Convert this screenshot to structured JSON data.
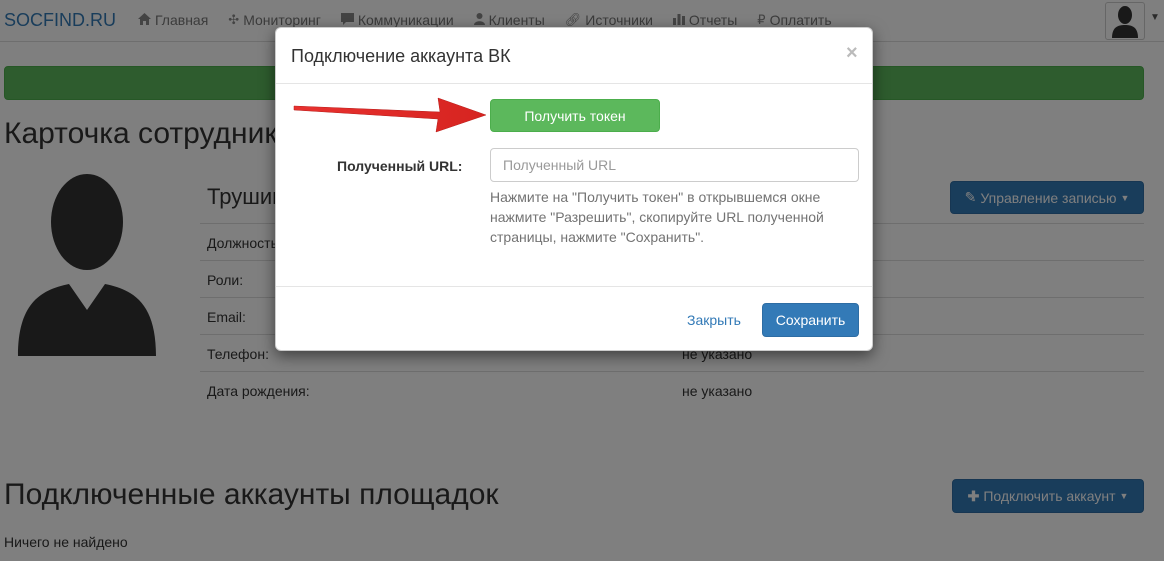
{
  "navbar": {
    "brand": "SOCFIND.RU",
    "items": [
      {
        "label": "Главная",
        "icon": "home-icon"
      },
      {
        "label": "Мониторинг",
        "icon": "crosshair-icon"
      },
      {
        "label": "Коммуникации",
        "icon": "comment-icon"
      },
      {
        "label": "Клиенты",
        "icon": "user-icon"
      },
      {
        "label": "Источники",
        "icon": "link-icon"
      },
      {
        "label": "Отчеты",
        "icon": "bar-chart-icon"
      },
      {
        "label": "Оплатить",
        "icon": "ruble-icon"
      }
    ]
  },
  "page": {
    "title": "Карточка сотрудника",
    "employee_name": "Трушин",
    "manage_button": "Управление записью",
    "rows": [
      {
        "label": "Должность:",
        "value": ""
      },
      {
        "label": "Роли:",
        "value": ""
      },
      {
        "label": "Email:",
        "value": ""
      },
      {
        "label": "Телефон:",
        "value": "не указано"
      },
      {
        "label": "Дата рождения:",
        "value": "не указано"
      }
    ],
    "accounts_title": "Подключенные аккаунты площадок",
    "connect_button": "Подключить аккаунт",
    "nothing_found": "Ничего не найдено"
  },
  "modal": {
    "title": "Подключение аккаунта ВК",
    "close_symbol": "×",
    "token_button": "Получить токен",
    "url_label": "Полученный URL:",
    "url_placeholder": "Полученный URL",
    "url_value": "",
    "help_text": "Нажмите на \"Получить токен\" в открывшемся окне нажмите \"Разрешить\", скопируйте URL полученной страницы, нажмите \"Сохранить\".",
    "close_link": "Закрыть",
    "save_button": "Сохранить"
  },
  "colors": {
    "primary": "#337ab7",
    "success": "#5cb85c",
    "arrow": "#e8312f"
  }
}
